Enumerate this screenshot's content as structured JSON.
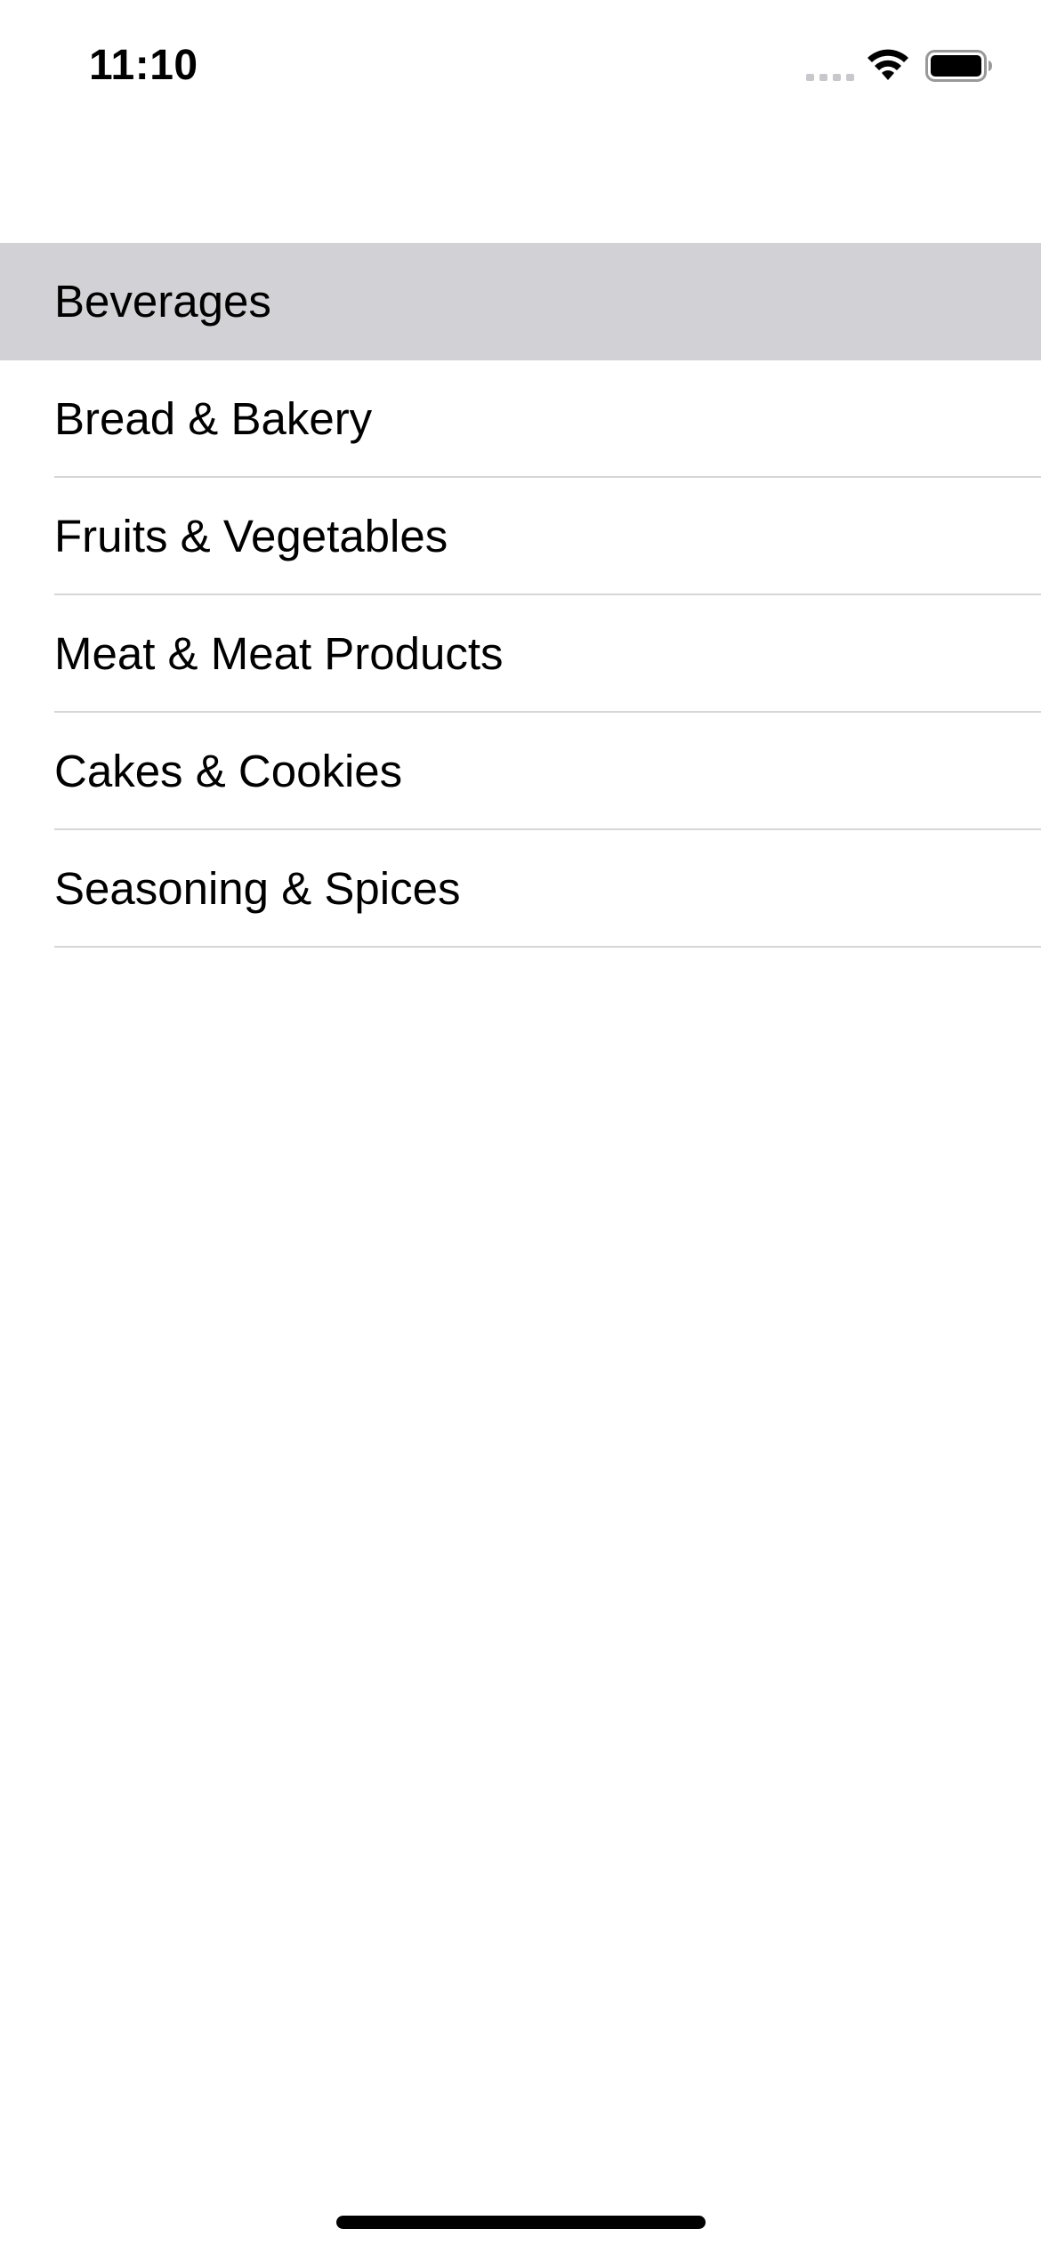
{
  "status_bar": {
    "time": "11:10",
    "icons": [
      "cellular-signal-icon",
      "wifi-icon",
      "battery-icon"
    ]
  },
  "category_list": {
    "selected_index": 0,
    "items": [
      {
        "label": "Beverages"
      },
      {
        "label": "Bread & Bakery"
      },
      {
        "label": "Fruits & Vegetables"
      },
      {
        "label": "Meat & Meat Products"
      },
      {
        "label": "Cakes & Cookies"
      },
      {
        "label": "Seasoning & Spices"
      }
    ]
  },
  "colors": {
    "selected_row": "#d1d1d6",
    "separator": "#d6d6d9",
    "text": "#000000",
    "background": "#ffffff"
  }
}
